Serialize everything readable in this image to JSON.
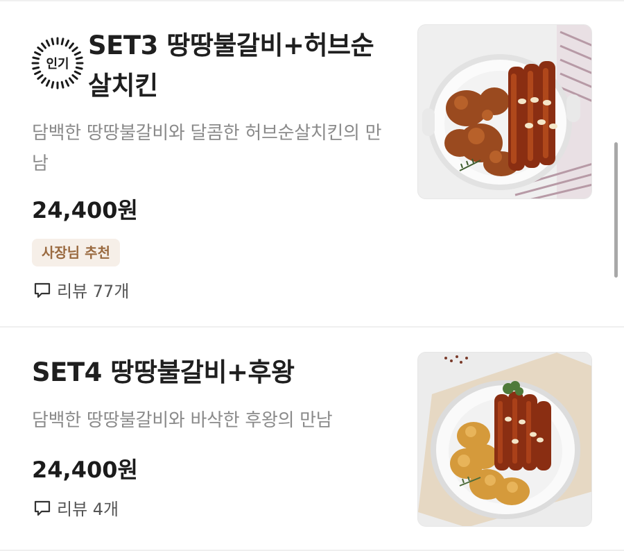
{
  "menu": [
    {
      "badge": "인기",
      "title": "SET3 땅땅불갈비+허브순살치킨",
      "description": "담백한 땅땅불갈비와 달콤한 허브순살치킨의 만남",
      "price": "24,400원",
      "tag": "사장님 추천",
      "reviews": "리뷰 77개",
      "image_icon": "food-photo-icon"
    },
    {
      "title": "SET4 땅땅불갈비+후왕",
      "description": "담백한 땅땅불갈비와 바삭한 후왕의 만남",
      "price": "24,400원",
      "reviews": "리뷰 4개",
      "image_icon": "food-photo-icon"
    }
  ],
  "colors": {
    "text": "#1b1b1b",
    "muted": "#8a8a8a",
    "tag_bg": "#f6efe8",
    "tag_text": "#9a6a40",
    "scrollbar": "#a8a8a8"
  }
}
